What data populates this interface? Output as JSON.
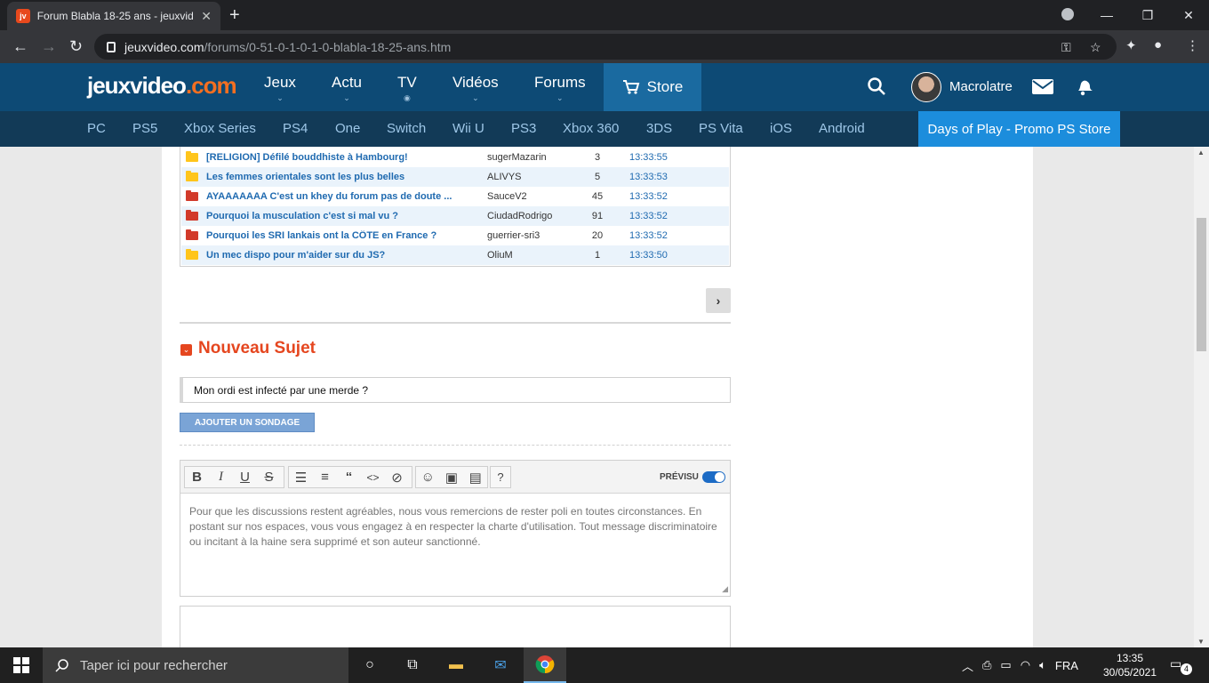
{
  "browser": {
    "tab_title": "Forum Blabla 18-25 ans - jeuxvideo.com",
    "url_host": "jeuxvideo.com",
    "url_path": "/forums/0-51-0-1-0-1-0-blabla-18-25-ans.htm"
  },
  "site": {
    "logo_main": "jeuxvideo",
    "logo_domain": ".com",
    "nav": [
      "Jeux",
      "Actu",
      "TV",
      "Vidéos",
      "Forums"
    ],
    "store_label": "Store",
    "username": "Macrolatre",
    "platforms": [
      "PC",
      "PS5",
      "Xbox Series",
      "PS4",
      "One",
      "Switch",
      "Wii U",
      "PS3",
      "Xbox 360",
      "3DS",
      "PS Vita",
      "iOS",
      "Android"
    ],
    "promo": "Days of Play - Promo PS Store"
  },
  "topics": [
    {
      "title": "[RELIGION] Défilé bouddhiste à Hambourg!",
      "author": "sugerMazarin",
      "replies": "3",
      "time": "13:33:55",
      "folder": "yellow"
    },
    {
      "title": "Les femmes orientales sont les plus belles",
      "author": "ALIVYS",
      "replies": "5",
      "time": "13:33:53",
      "folder": "yellow"
    },
    {
      "title": "AYAAAAAAA C'est un khey du forum pas de doute ...",
      "author": "SauceV2",
      "replies": "45",
      "time": "13:33:52",
      "folder": "red"
    },
    {
      "title": "Pourquoi la musculation c'est si mal vu ?",
      "author": "CiudadRodrigo",
      "replies": "91",
      "time": "13:33:52",
      "folder": "red"
    },
    {
      "title": "Pourquoi les SRI lankais ont la CÔTE en France ?",
      "author": "guerrier-sri3",
      "replies": "20",
      "time": "13:33:52",
      "folder": "red"
    },
    {
      "title": "Un mec dispo pour m'aider sur du JS?",
      "author": "OliuM",
      "replies": "1",
      "time": "13:33:50",
      "folder": "yellow"
    }
  ],
  "new_topic": {
    "heading": "Nouveau Sujet",
    "subject_value": "Mon ordi est infecté par une merde  ?",
    "poll_button": "AJOUTER UN SONDAGE",
    "preview_label": "PRÉVISU",
    "message_placeholder": "Pour que les discussions restent agréables, nous vous remercions de rester poli en toutes circonstances. En postant sur nos espaces, vous vous engagez à en respecter la charte d'utilisation. Tout message discriminatoire ou incitant à la haine sera supprimé et son auteur sanctionné."
  },
  "taskbar": {
    "search_placeholder": "Taper ici pour rechercher",
    "lang": "FRA",
    "time": "13:35",
    "date": "30/05/2021",
    "notif_count": "4"
  },
  "colors": {
    "header_bg": "#0d4a75",
    "subnav_bg": "#123a57",
    "accent_orange": "#e5461f",
    "link_blue": "#1f6ab0",
    "promo_blue": "#1c8ddc"
  }
}
